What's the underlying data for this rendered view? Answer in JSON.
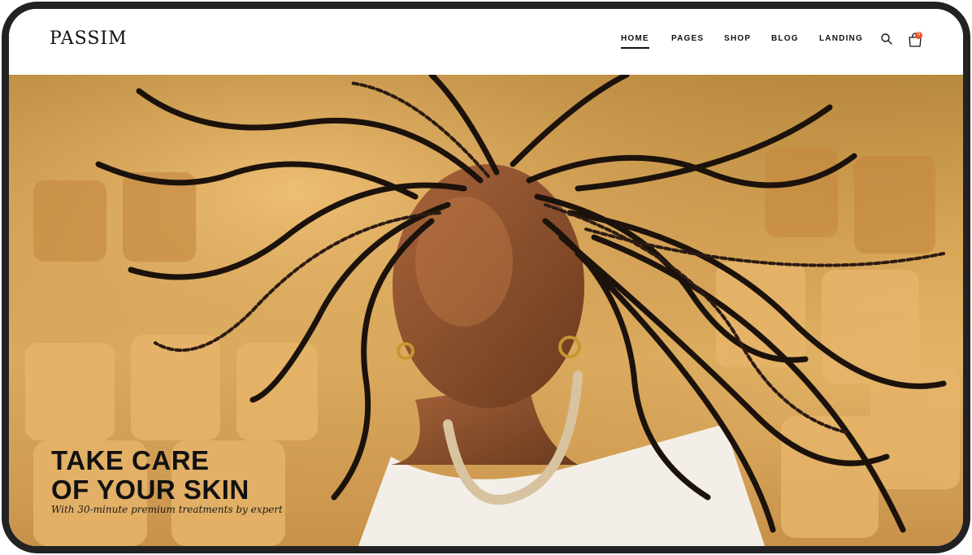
{
  "brand": {
    "logo": "PASSIM"
  },
  "nav": {
    "items": [
      {
        "label": "HOME",
        "active": true
      },
      {
        "label": "PAGES"
      },
      {
        "label": "SHOP"
      },
      {
        "label": "BLOG"
      },
      {
        "label": "LANDING"
      }
    ],
    "search_icon": "search-icon",
    "cart_icon": "cart-icon",
    "cart_count": "0"
  },
  "hero": {
    "title_line1": "TAKE CARE",
    "title_line2": "OF YOUR SKIN",
    "subtitle": "With 30-minute premium treatments by expert",
    "image": "woman-with-braids-photo"
  },
  "colors": {
    "accent": "#e8502a",
    "text": "#111111",
    "hero_tone": "#d8a657",
    "frame": "#222222"
  }
}
